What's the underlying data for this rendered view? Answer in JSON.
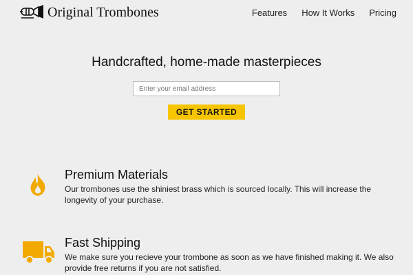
{
  "brand": {
    "name": "Original Trombones",
    "icon": "trombone-icon"
  },
  "nav": {
    "items": [
      {
        "label": "Features"
      },
      {
        "label": "How It Works"
      },
      {
        "label": "Pricing"
      }
    ]
  },
  "hero": {
    "title": "Handcrafted, home-made masterpieces",
    "email_placeholder": "Enter your email address",
    "email_value": "",
    "cta_label": "GET STARTED"
  },
  "features": [
    {
      "icon": "flame-icon",
      "title": "Premium Materials",
      "description": "Our trombones use the shiniest brass which is sourced locally. This will increase the longevity of your purchase."
    },
    {
      "icon": "truck-icon",
      "title": "Fast Shipping",
      "description": "We make sure you recieve your trombone as soon as we have finished making it. We also provide free returns if you are not satisfied."
    }
  ],
  "colors": {
    "background": "#eeeeee",
    "accent": "#f7c500",
    "icon_orange": "#f2a900",
    "text": "#111111"
  }
}
